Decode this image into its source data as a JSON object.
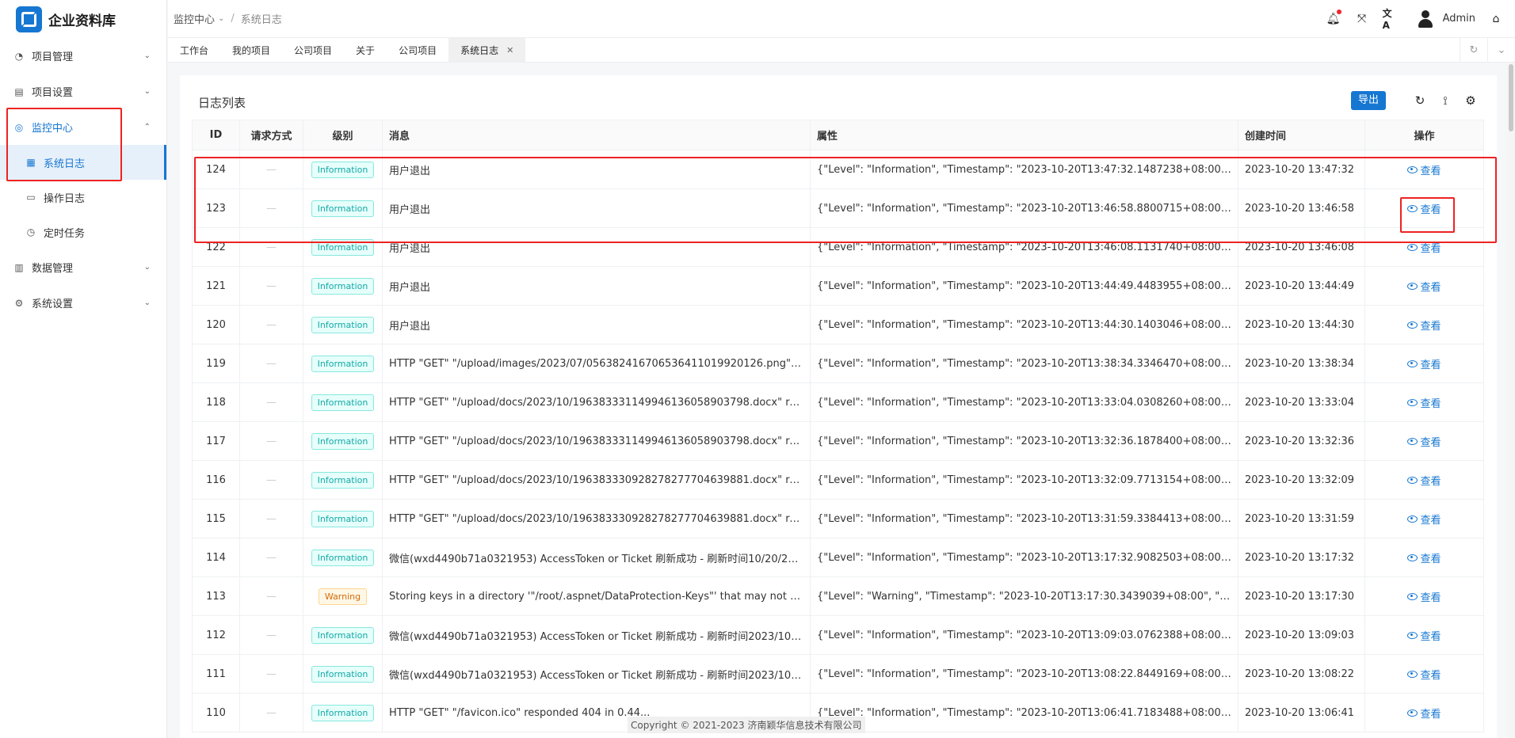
{
  "app": {
    "title": "企业资料库"
  },
  "breadcrumb": {
    "parent": "监控中心",
    "current": "系统日志"
  },
  "header": {
    "username": "Admin"
  },
  "sidebar": {
    "items": [
      {
        "label": "项目管理",
        "icon": "dashboard-icon"
      },
      {
        "label": "项目设置",
        "icon": "list-icon"
      },
      {
        "label": "监控中心",
        "icon": "monitor-icon",
        "active": true,
        "children": [
          {
            "label": "系统日志",
            "icon": "table-icon",
            "selected": true
          },
          {
            "label": "操作日志",
            "icon": "laptop-icon"
          },
          {
            "label": "定时任务",
            "icon": "clock-icon"
          }
        ]
      },
      {
        "label": "数据管理",
        "icon": "database-icon"
      },
      {
        "label": "系统设置",
        "icon": "gear-icon"
      }
    ]
  },
  "tabs": [
    {
      "label": "工作台"
    },
    {
      "label": "我的项目"
    },
    {
      "label": "公司项目"
    },
    {
      "label": "关于"
    },
    {
      "label": "公司项目"
    },
    {
      "label": "系统日志",
      "active": true
    }
  ],
  "card": {
    "title": "日志列表",
    "export_label": "导出"
  },
  "table": {
    "columns": [
      "ID",
      "请求方式",
      "级别",
      "消息",
      "属性",
      "创建时间",
      "操作"
    ],
    "view_label": "查看",
    "dash": "—",
    "rows": [
      {
        "id": "124",
        "level": "Information",
        "message": "用户退出",
        "props": "{\"Level\": \"Information\", \"Timestamp\": \"2023-10-20T13:47:32.1487238+08:00\", \"Prop...",
        "time": "2023-10-20 13:47:32"
      },
      {
        "id": "123",
        "level": "Information",
        "message": "用户退出",
        "props": "{\"Level\": \"Information\", \"Timestamp\": \"2023-10-20T13:46:58.8800715+08:00\", \"Prop...",
        "time": "2023-10-20 13:46:58"
      },
      {
        "id": "122",
        "level": "Information",
        "message": "用户退出",
        "props": "{\"Level\": \"Information\", \"Timestamp\": \"2023-10-20T13:46:08.1131740+08:00\", \"Prop...",
        "time": "2023-10-20 13:46:08"
      },
      {
        "id": "121",
        "level": "Information",
        "message": "用户退出",
        "props": "{\"Level\": \"Information\", \"Timestamp\": \"2023-10-20T13:44:49.4483955+08:00\", \"Prop...",
        "time": "2023-10-20 13:44:49"
      },
      {
        "id": "120",
        "level": "Information",
        "message": "用户退出",
        "props": "{\"Level\": \"Information\", \"Timestamp\": \"2023-10-20T13:44:30.1403046+08:00\", \"Prop...",
        "time": "2023-10-20 13:44:30"
      },
      {
        "id": "119",
        "level": "Information",
        "message": "HTTP \"GET\" \"/upload/images/2023/07/056382416706536411019920126.png\" resp...",
        "props": "{\"Level\": \"Information\", \"Timestamp\": \"2023-10-20T13:38:34.3346470+08:00\", \"Prop...",
        "time": "2023-10-20 13:38:34"
      },
      {
        "id": "118",
        "level": "Information",
        "message": "HTTP \"GET\" \"/upload/docs/2023/10/196383331149946136058903798.docx\" respo...",
        "props": "{\"Level\": \"Information\", \"Timestamp\": \"2023-10-20T13:33:04.0308260+08:00\", \"Prop...",
        "time": "2023-10-20 13:33:04"
      },
      {
        "id": "117",
        "level": "Information",
        "message": "HTTP \"GET\" \"/upload/docs/2023/10/196383331149946136058903798.docx\" respo...",
        "props": "{\"Level\": \"Information\", \"Timestamp\": \"2023-10-20T13:32:36.1878400+08:00\", \"Prop...",
        "time": "2023-10-20 13:32:36"
      },
      {
        "id": "116",
        "level": "Information",
        "message": "HTTP \"GET\" \"/upload/docs/2023/10/196383330928278277704639881.docx\" respo...",
        "props": "{\"Level\": \"Information\", \"Timestamp\": \"2023-10-20T13:32:09.7713154+08:00\", \"Prop...",
        "time": "2023-10-20 13:32:09"
      },
      {
        "id": "115",
        "level": "Information",
        "message": "HTTP \"GET\" \"/upload/docs/2023/10/196383330928278277704639881.docx\" respo...",
        "props": "{\"Level\": \"Information\", \"Timestamp\": \"2023-10-20T13:31:59.3384413+08:00\", \"Prop...",
        "time": "2023-10-20 13:31:59"
      },
      {
        "id": "114",
        "level": "Information",
        "message": "微信(wxd4490b71a0321953) AccessToken or Ticket 刷新成功 - 刷新时间10/20/202...",
        "props": "{\"Level\": \"Information\", \"Timestamp\": \"2023-10-20T13:17:32.9082503+08:00\", \"Prop...",
        "time": "2023-10-20 13:17:32"
      },
      {
        "id": "113",
        "level": "Warning",
        "message": "Storing keys in a directory '\"/root/.aspnet/DataProtection-Keys\"' that may not be p...",
        "props": "{\"Level\": \"Warning\", \"Timestamp\": \"2023-10-20T13:17:30.3439039+08:00\", \"Properti...",
        "time": "2023-10-20 13:17:30"
      },
      {
        "id": "112",
        "level": "Information",
        "message": "微信(wxd4490b71a0321953) AccessToken or Ticket 刷新成功 - 刷新时间2023/10/2...",
        "props": "{\"Level\": \"Information\", \"Timestamp\": \"2023-10-20T13:09:03.0762388+08:00\", \"Prop...",
        "time": "2023-10-20 13:09:03"
      },
      {
        "id": "111",
        "level": "Information",
        "message": "微信(wxd4490b71a0321953) AccessToken or Ticket 刷新成功 - 刷新时间2023/10/2...",
        "props": "{\"Level\": \"Information\", \"Timestamp\": \"2023-10-20T13:08:22.8449169+08:00\", \"Prop...",
        "time": "2023-10-20 13:08:22"
      },
      {
        "id": "110",
        "level": "Information",
        "message": "HTTP \"GET\" \"/favicon.ico\" responded 404 in 0.44...",
        "props": "{\"Level\": \"Information\", \"Timestamp\": \"2023-10-20T13:06:41.7183488+08:00\", \"Prop...",
        "time": "2023-10-20 13:06:41"
      }
    ]
  },
  "footer": {
    "copyright": "Copyright © 2021-2023 济南颖华信息技术有限公司"
  },
  "colors": {
    "accent": "#1677d2",
    "highlight": "#e22222",
    "info": "#13a8a8",
    "warning": "#d46b08"
  }
}
